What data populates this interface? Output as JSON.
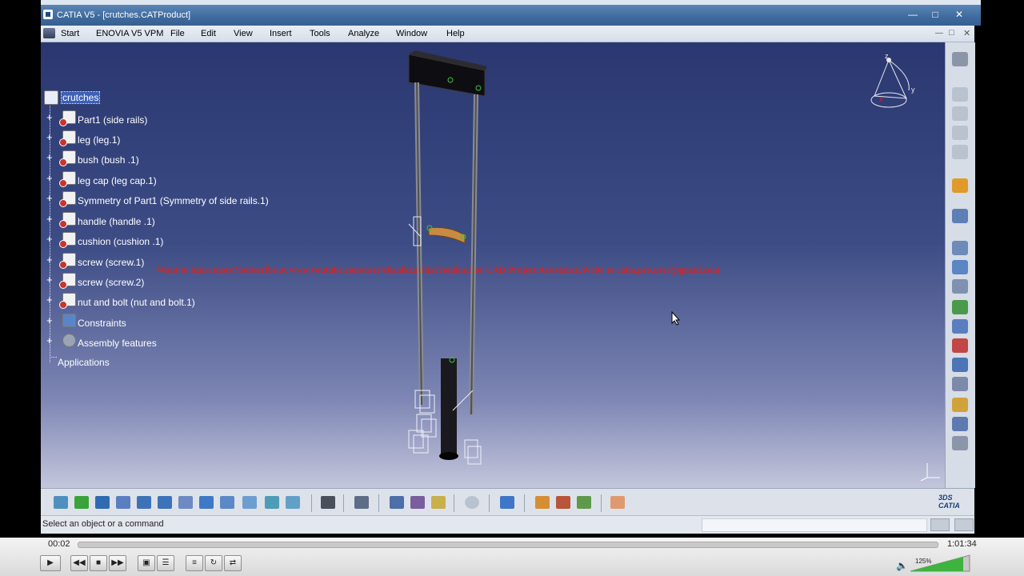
{
  "window": {
    "title": "CATIA V5 - [crutches.CATProduct]",
    "controls": [
      "minimize-icon",
      "restore-icon",
      "close-icon"
    ]
  },
  "menu": {
    "start": "Start",
    "enovia": "ENOVIA V5 VPM",
    "items": [
      "File",
      "Edit",
      "View",
      "Insert",
      "Tools",
      "Analyze",
      "Window",
      "Help"
    ]
  },
  "tree": {
    "root": "crutches",
    "items": [
      "Part1 (side rails)",
      "leg (leg.1)",
      "bush  (bush .1)",
      "leg cap (leg cap.1)",
      "Symmetry of Part1 (Symmetry of side rails.1)",
      "handle  (handle .1)",
      "cushion  (cushion .1)",
      "screw (screw.1)",
      "screw (screw.2)",
      "nut and  bolt (nut and  bolt.1)",
      "Constraints",
      "Assembly features"
    ],
    "applications": "Applications"
  },
  "watermark": "Want to learn more?Subscribe at www.youtube.com/user/shaaikzaritiar?online.For CAD Project Assistance,Write to catia.pro.user@gmail.com",
  "status": {
    "prompt": "Select an object or a command"
  },
  "player": {
    "elapsed": "00:02",
    "duration": "1:01:34",
    "zoom": "125%",
    "progress_fraction": 0.0
  },
  "colors": {
    "viewport_top": "#2a3770",
    "viewport_bottom": "#c4c6dc",
    "watermark": "#d42323",
    "title_bar": "#3e6a9d"
  }
}
